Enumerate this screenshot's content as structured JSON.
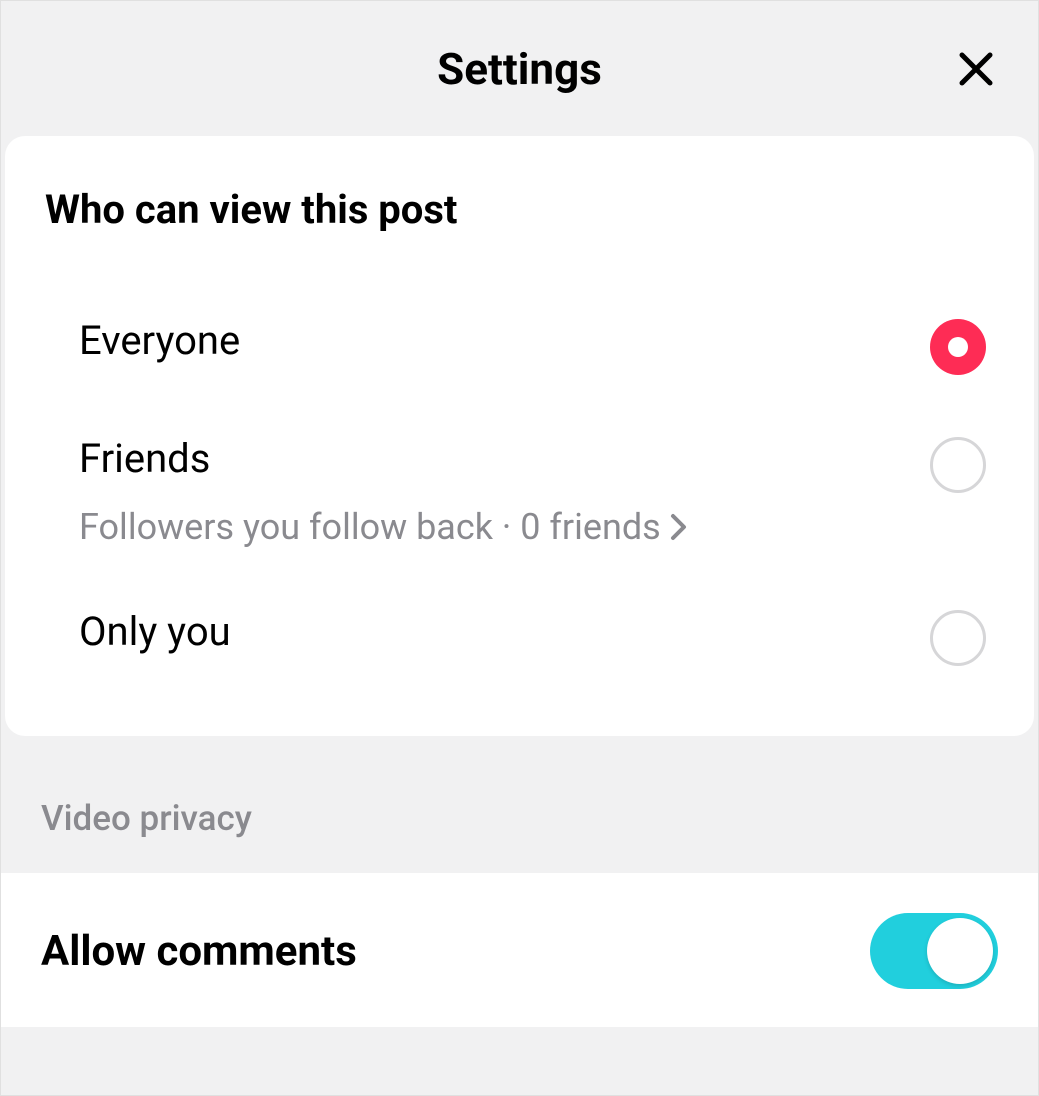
{
  "header": {
    "title": "Settings"
  },
  "visibility": {
    "section_title": "Who can view this post",
    "options": [
      {
        "label": "Everyone",
        "sublabel": "",
        "selected": true
      },
      {
        "label": "Friends",
        "sublabel": "Followers you follow back · 0 friends",
        "selected": false,
        "has_chevron": true
      },
      {
        "label": "Only you",
        "sublabel": "",
        "selected": false
      }
    ]
  },
  "video_privacy": {
    "section_header": "Video privacy",
    "allow_comments": {
      "label": "Allow comments",
      "enabled": true
    }
  }
}
